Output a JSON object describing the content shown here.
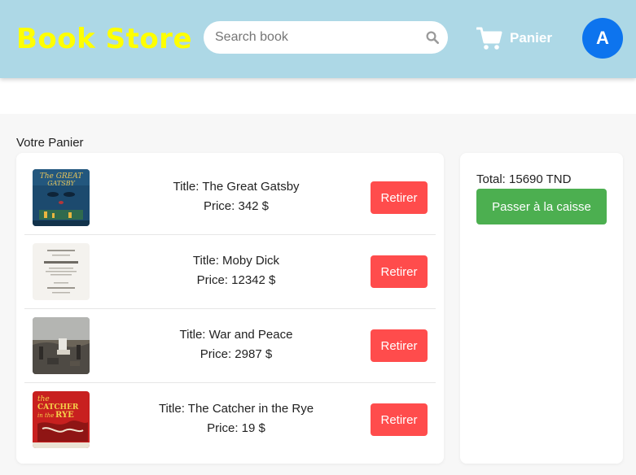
{
  "header": {
    "logo": "Book Store",
    "search_placeholder": "Search book",
    "search_value": "",
    "cart_label": "Panier",
    "avatar_initial": "A"
  },
  "colors": {
    "header_bg": "#add8e6",
    "logo": "#ffff00",
    "avatar_bg": "#0d74ee",
    "remove_button": "#ff4c4c",
    "checkout_button": "#4caf50"
  },
  "cart": {
    "title": "Votre Panier",
    "items": [
      {
        "title": "Title: The Great Gatsby",
        "price": "Price: 342 $",
        "remove_label": "Retirer",
        "cover": "great-gatsby-cover"
      },
      {
        "title": "Title: Moby Dick",
        "price": "Price: 12342 $",
        "remove_label": "Retirer",
        "cover": "moby-dick-cover"
      },
      {
        "title": "Title: War and Peace",
        "price": "Price: 2987 $",
        "remove_label": "Retirer",
        "cover": "war-and-peace-cover"
      },
      {
        "title": "Title: The Catcher in the Rye",
        "price": "Price: 19 $",
        "remove_label": "Retirer",
        "cover": "catcher-in-the-rye-cover"
      }
    ]
  },
  "summary": {
    "total": "Total: 15690 TND",
    "checkout_label": "Passer à la caisse"
  }
}
